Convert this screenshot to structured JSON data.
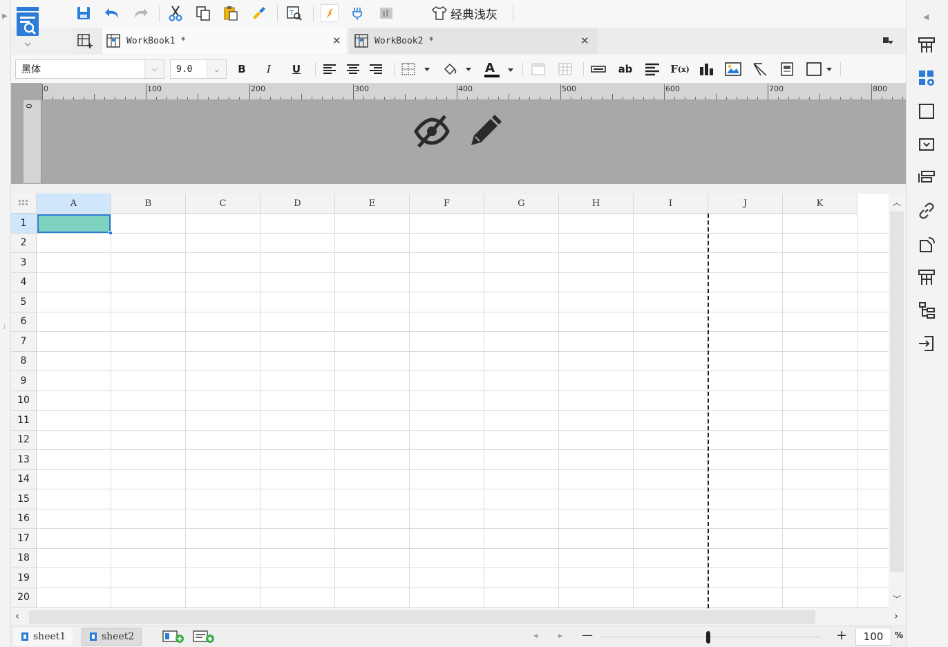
{
  "toolbar": {
    "theme_label": "经典浅灰"
  },
  "tabs": [
    {
      "label": "WorkBook1 *"
    },
    {
      "label": "WorkBook2 *"
    }
  ],
  "format": {
    "font_family": "黑体",
    "font_size": "9.0"
  },
  "ruler": {
    "marks": [
      "0",
      "100",
      "200",
      "300",
      "400",
      "500",
      "600",
      "700",
      "800"
    ],
    "vertical_zero": "0"
  },
  "grid": {
    "columns": [
      "A",
      "B",
      "C",
      "D",
      "E",
      "F",
      "G",
      "H",
      "I",
      "J",
      "K"
    ],
    "rows": [
      "1",
      "2",
      "3",
      "4",
      "5",
      "6",
      "7",
      "8",
      "9",
      "10",
      "11",
      "12",
      "13",
      "14",
      "15",
      "16",
      "17",
      "18",
      "19",
      "20"
    ],
    "selected_cell": "A1",
    "selection_color": "#7dd3c0"
  },
  "sheets": [
    {
      "label": "sheet1"
    },
    {
      "label": "sheet2"
    }
  ],
  "zoom": {
    "value": "100",
    "unit": "%"
  },
  "colors": {
    "accent": "#2b7bd8",
    "orange": "#f08a00"
  }
}
